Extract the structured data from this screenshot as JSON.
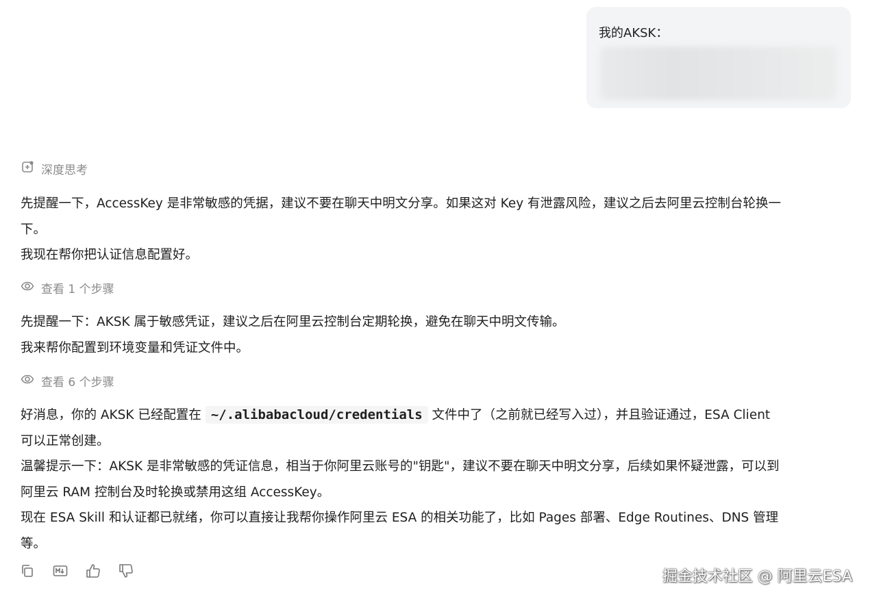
{
  "user_message": {
    "label": "我的AKSK："
  },
  "thinking": {
    "label": "深度思考"
  },
  "block1": {
    "line1": "先提醒一下，AccessKey 是非常敏感的凭据，建议不要在聊天中明文分享。如果这对 Key 有泄露风险，建议之后去阿里云控制台轮换一",
    "line2": "下。",
    "line3": "我现在帮你把认证信息配置好。"
  },
  "steps1": {
    "label": "查看 1 个步骤"
  },
  "block2": {
    "line1": "先提醒一下：AKSK 属于敏感凭证，建议之后在阿里云控制台定期轮换，避免在聊天中明文传输。",
    "line2": "我来帮你配置到环境变量和凭证文件中。"
  },
  "steps2": {
    "label": "查看 6 个步骤"
  },
  "block3": {
    "l1_pre": "好消息，你的 AKSK 已经配置在 ",
    "l1_code": "~/.alibabacloud/credentials",
    "l1_post": " 文件中了（之前就已经写入过），并且验证通过，ESA Client",
    "line2": "可以正常创建。",
    "line3": "温馨提示一下：AKSK 是非常敏感的凭证信息，相当于你阿里云账号的\"钥匙\"，建议不要在聊天中明文分享，后续如果怀疑泄露，可以到",
    "line4": "阿里云 RAM 控制台及时轮换或禁用这组 AccessKey。",
    "line5": "现在 ESA Skill 和认证都已就绪，你可以直接让我帮你操作阿里云 ESA 的相关功能了，比如 Pages 部署、Edge Routines、DNS 管理",
    "line6": "等。"
  },
  "actions": {
    "icons": [
      "copy-icon",
      "markdown-icon",
      "thumbs-up-icon",
      "thumbs-down-icon"
    ]
  },
  "watermark": {
    "text": "掘金技术社区 @ 阿里云ESA"
  },
  "colors": {
    "meta": "#8a8a8a",
    "bubble": "#f3f4f5",
    "text": "#1f1f1f"
  }
}
